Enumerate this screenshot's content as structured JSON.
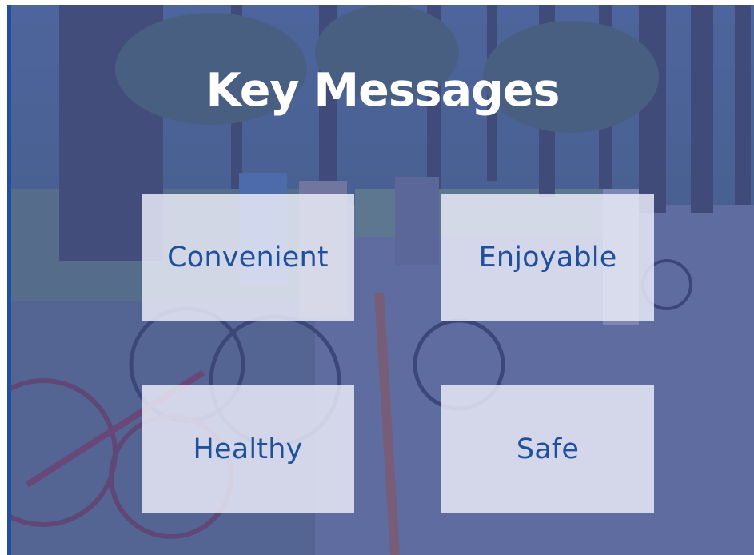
{
  "slide": {
    "title": "Key Messages",
    "messages": [
      {
        "label": "Convenient"
      },
      {
        "label": "Enjoyable"
      },
      {
        "label": "Healthy"
      },
      {
        "label": "Safe"
      }
    ]
  },
  "colors": {
    "accent_blue": "#1e4fa0",
    "overlay_tint": "#4658a8",
    "card_text": "#1f4f9d",
    "card_background": "#ebecf8",
    "title_text": "#ffffff"
  }
}
